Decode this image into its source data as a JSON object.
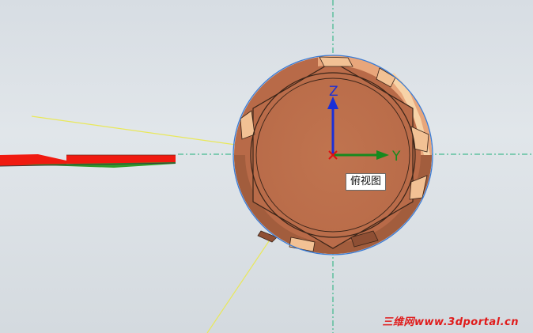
{
  "viewport": {
    "view_label": "俯视图",
    "axes": {
      "z": "Z",
      "y": "Y"
    },
    "watermark": "三维网www.3dportal.cn"
  },
  "colors": {
    "part_fill": "#bd7050",
    "part_highlight": "#f0b98a",
    "axis_z": "#1a2fd8",
    "axis_y": "#168a1e",
    "origin": "#e01010",
    "selection_outline": "#3a7bd5",
    "centerline": "#1fb07a",
    "construction_line": "#e9e85a",
    "edge_part_red": "#f01a10"
  }
}
